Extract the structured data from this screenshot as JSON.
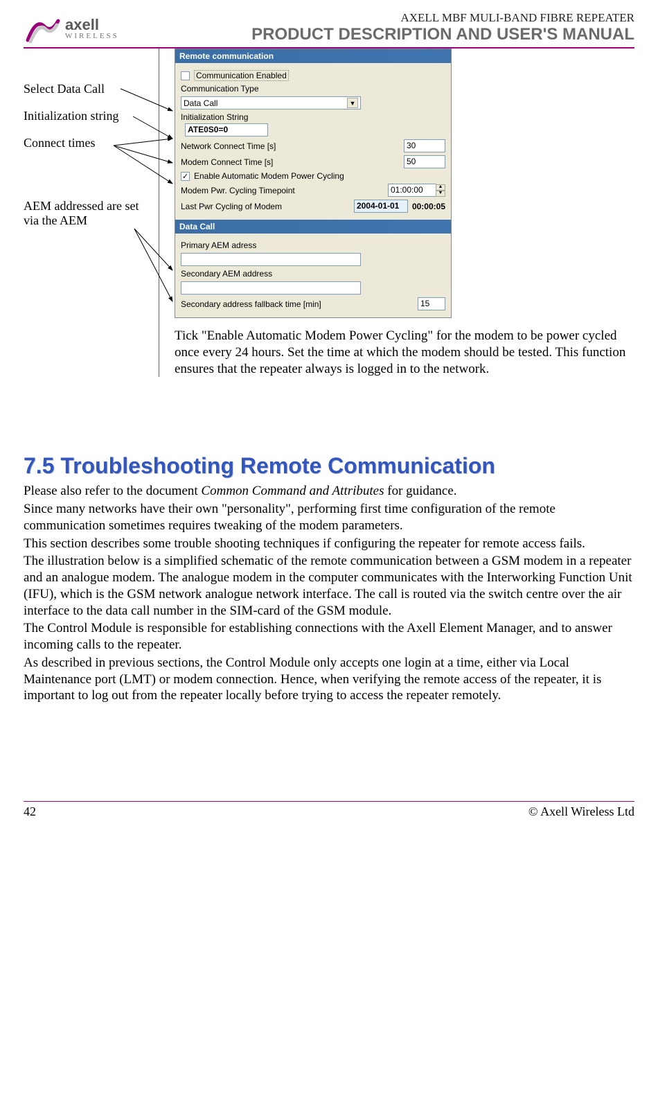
{
  "header": {
    "small": "AXELL MBF MULI-BAND FIBRE REPEATER",
    "big": "PRODUCT DESCRIPTION AND USER'S MANUAL",
    "logo_name": "axell",
    "logo_sub": "WIRELESS"
  },
  "callouts": {
    "select_data_call": "Select Data Call",
    "init_string": "Initialization string",
    "connect_times": "Connect times",
    "aem": "AEM addressed are set via the AEM"
  },
  "panel": {
    "remote_hdr": "Remote communication",
    "comm_enabled_label": "Communication Enabled",
    "comm_enabled_checked": false,
    "comm_type_label": "Communication Type",
    "comm_type_value": "Data Call",
    "init_string_label": "Initialization String",
    "init_string_value": "ATE0S0=0",
    "net_connect_label": "Network Connect Time [s]",
    "net_connect_value": "30",
    "modem_connect_label": "Modem Connect Time [s]",
    "modem_connect_value": "50",
    "enable_cycle_label": "Enable Automatic Modem Power Cycling",
    "enable_cycle_checked": true,
    "cycle_time_label": "Modem Pwr. Cycling Timepoint",
    "cycle_time_value": "01:00:00",
    "last_cycle_label": "Last Pwr Cycling of Modem",
    "last_cycle_date": "2004-01-01",
    "last_cycle_time": "00:00:05",
    "datacall_hdr": "Data Call",
    "primary_aem_label": "Primary AEM adress",
    "primary_aem_value": "",
    "secondary_aem_label": "Secondary AEM address",
    "secondary_aem_value": "",
    "fallback_label": "Secondary address fallback time [min]",
    "fallback_value": "15"
  },
  "tick_paragraph": "Tick \"Enable Automatic Modem Power Cycling\" for the modem to be power cycled once every 24 hours. Set the time at which the modem should be tested. This function ensures that the repeater always is logged in to the network.",
  "section": {
    "heading": "7.5  Troubleshooting Remote Communication",
    "p1_a": "Please also refer to the document ",
    "p1_i": "Common Command and Attributes",
    "p1_b": " for guidance.",
    "p2": "Since many networks have their own \"personality\", performing first time configuration of the remote communication sometimes requires tweaking of the modem parameters.",
    "p3": "This section describes some trouble shooting techniques if configuring the repeater for remote access fails.",
    "p4": "The illustration below is a simplified schematic of the remote communication between a GSM modem in a repeater and an analogue modem. The analogue modem in the computer communicates with the Interworking Function Unit (IFU), which is the GSM network analogue network interface. The call is routed via the switch centre over the air interface to the data call number in the SIM-card of the GSM module.",
    "p5": "The Control Module is responsible for establishing connections with the Axell Element Manager, and to answer incoming calls to the repeater.",
    "p6": "As described in previous sections, the Control Module only accepts one login at a time, either via Local Maintenance port (LMT) or modem connection. Hence, when verifying the remote access of the repeater, it is important to log out from the repeater locally before trying to access the repeater remotely."
  },
  "footer": {
    "page": "42",
    "copyright": "© Axell Wireless Ltd"
  }
}
